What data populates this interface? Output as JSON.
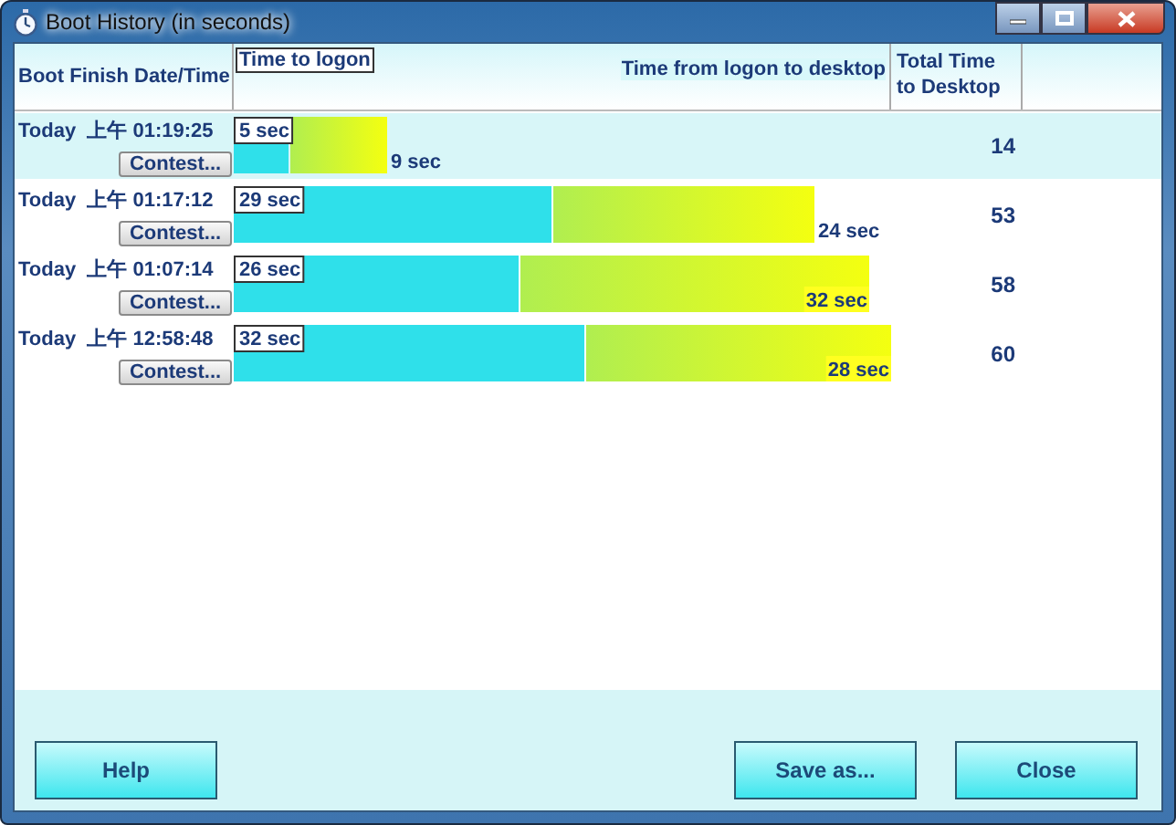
{
  "window": {
    "title": "Boot History (in seconds)"
  },
  "columns": [
    "Boot Finish Date/Time",
    "Total Time to Desktop"
  ],
  "rows": [
    {
      "date": "Today  上午 01:19:25",
      "button": "Contest...",
      "total": "14",
      "selected": true
    },
    {
      "date": "Today  上午 01:17:12",
      "button": "Contest...",
      "total": "53",
      "selected": false
    },
    {
      "date": "Today  上午 01:07:14",
      "button": "Contest...",
      "total": "58",
      "selected": false
    },
    {
      "date": "Today  上午 12:58:48",
      "button": "Contest...",
      "total": "60",
      "selected": false
    }
  ],
  "chart_data": {
    "type": "bar",
    "orientation": "horizontal",
    "stacked": true,
    "series": [
      {
        "name": "Time to logon",
        "color": "#2fe0ea",
        "values": [
          5,
          29,
          26,
          32
        ],
        "value_labels": [
          "5 sec",
          "29 sec",
          "26 sec",
          "32 sec"
        ]
      },
      {
        "name": "Time from logon to desktop",
        "color": "#b0ee50",
        "values": [
          9,
          24,
          32,
          28
        ],
        "value_labels": [
          "9 sec",
          "24 sec",
          "32 sec",
          "28 sec"
        ]
      }
    ]
  },
  "footer": {
    "left_buttons": [
      "Help"
    ],
    "right_buttons": [
      "Save as...",
      "Close"
    ]
  }
}
